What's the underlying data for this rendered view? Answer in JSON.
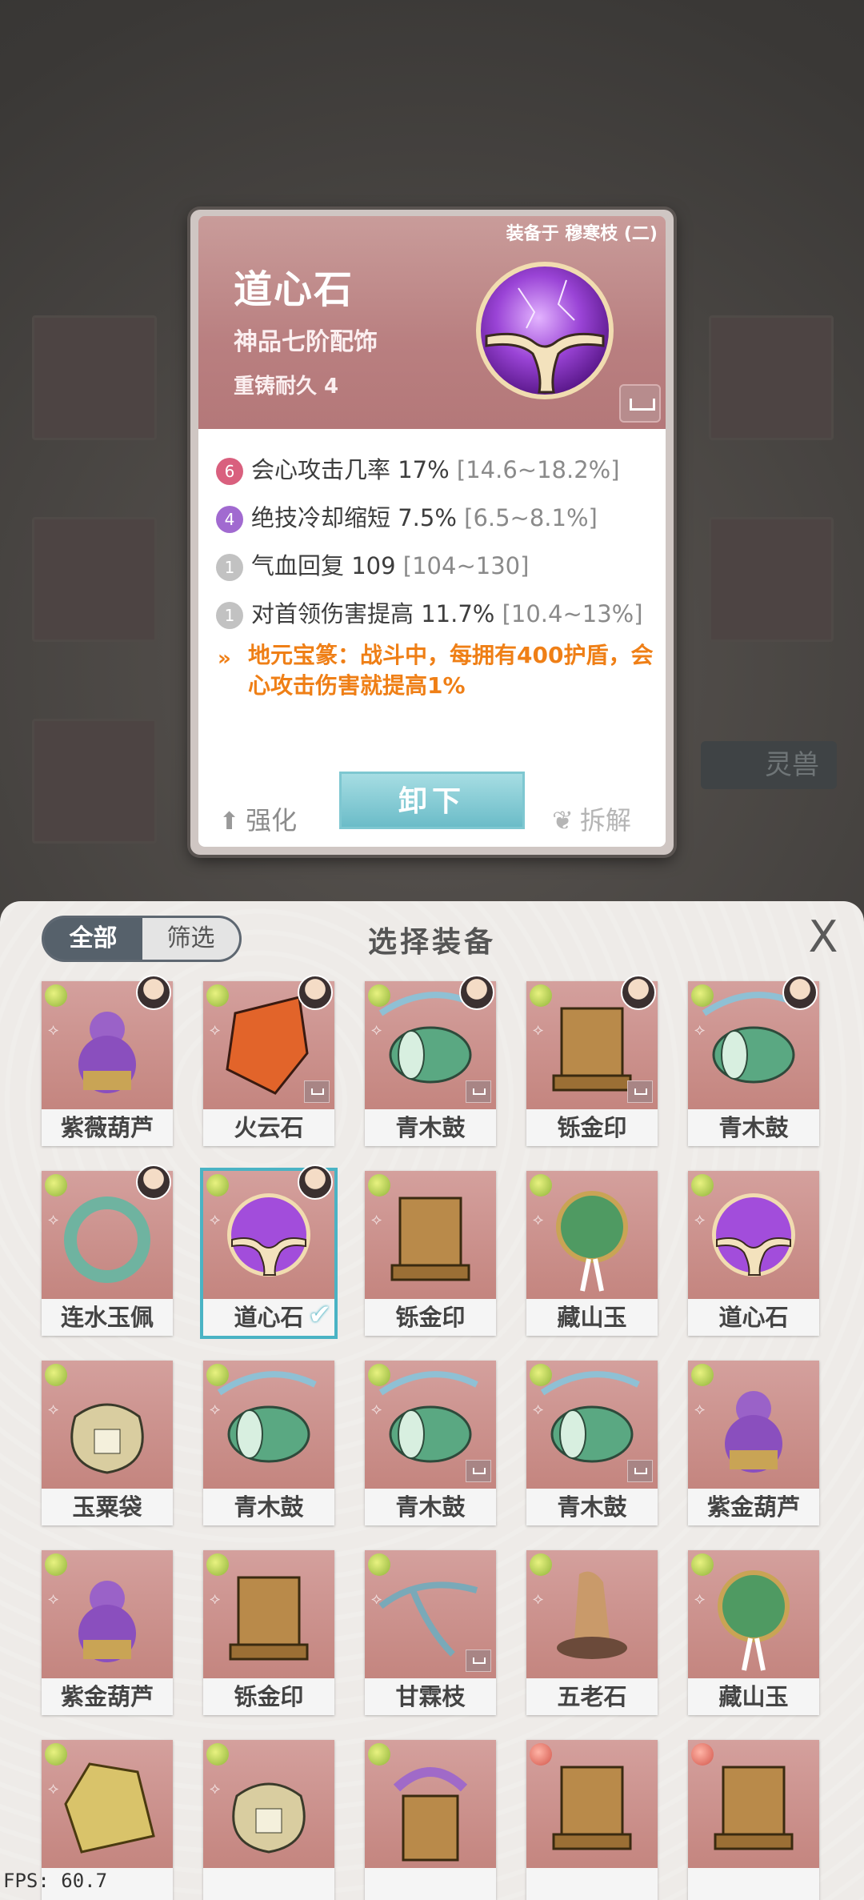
{
  "detail": {
    "equipped_text": "装备于 穆寒枝 (二)",
    "name": "道心石",
    "grade": "神品七阶配饰",
    "durability": "重铸耐久 4",
    "stats": [
      {
        "badge": "6",
        "badge_color": "#d9607e",
        "label": "会心攻击几率 17%",
        "range": "[14.6~18.2%]"
      },
      {
        "badge": "4",
        "badge_color": "#a16ad0",
        "label": "绝技冷却缩短 7.5%",
        "range": "[6.5~8.1%]"
      },
      {
        "badge": "1",
        "badge_color": "#c2c2c2",
        "label": "气血回复 109",
        "range": "[104~130]"
      },
      {
        "badge": "1",
        "badge_color": "#c2c2c2",
        "label": "对首领伤害提高 11.7%",
        "range": "[10.4~13%]"
      }
    ],
    "skill_icon": "»",
    "skill_text": "地元宝篆：战斗中，每拥有400护盾，会心攻击伤害就提高1%",
    "enhance_label": "强化",
    "unequip_label": "卸下",
    "disassemble_label": "拆解"
  },
  "panel": {
    "title": "选择装备",
    "tab_all": "全部",
    "tab_filter": "筛选",
    "close_glyph": "X"
  },
  "items": [
    {
      "name": "紫薇葫芦",
      "grade": "green",
      "avatar": true,
      "lock": false,
      "selected": false,
      "icon": "gourd-icon"
    },
    {
      "name": "火云石",
      "grade": "green",
      "avatar": true,
      "lock": true,
      "selected": false,
      "icon": "fire-stone-icon"
    },
    {
      "name": "青木鼓",
      "grade": "green",
      "avatar": true,
      "lock": true,
      "selected": false,
      "icon": "drum-icon"
    },
    {
      "name": "铄金印",
      "grade": "green",
      "avatar": true,
      "lock": true,
      "selected": false,
      "icon": "seal-icon"
    },
    {
      "name": "青木鼓",
      "grade": "green",
      "avatar": true,
      "lock": false,
      "selected": false,
      "icon": "drum-icon"
    },
    {
      "name": "连水玉佩",
      "grade": "green",
      "avatar": true,
      "lock": false,
      "selected": false,
      "icon": "jade-ring-icon"
    },
    {
      "name": "道心石",
      "grade": "green",
      "avatar": true,
      "lock": false,
      "selected": true,
      "icon": "orb-icon"
    },
    {
      "name": "铄金印",
      "grade": "green",
      "avatar": false,
      "lock": false,
      "selected": false,
      "icon": "seal-icon"
    },
    {
      "name": "藏山玉",
      "grade": "green",
      "avatar": false,
      "lock": false,
      "selected": false,
      "icon": "jade-pendant-icon"
    },
    {
      "name": "道心石",
      "grade": "green",
      "avatar": false,
      "lock": false,
      "selected": false,
      "icon": "orb-icon"
    },
    {
      "name": "玉粟袋",
      "grade": "green",
      "avatar": false,
      "lock": false,
      "selected": false,
      "icon": "pouch-icon"
    },
    {
      "name": "青木鼓",
      "grade": "green",
      "avatar": false,
      "lock": false,
      "selected": false,
      "icon": "drum-icon"
    },
    {
      "name": "青木鼓",
      "grade": "green",
      "avatar": false,
      "lock": true,
      "selected": false,
      "icon": "drum-icon"
    },
    {
      "name": "青木鼓",
      "grade": "green",
      "avatar": false,
      "lock": true,
      "selected": false,
      "icon": "drum-icon"
    },
    {
      "name": "紫金葫芦",
      "grade": "green",
      "avatar": false,
      "lock": false,
      "selected": false,
      "icon": "gourd-icon"
    },
    {
      "name": "紫金葫芦",
      "grade": "green",
      "avatar": false,
      "lock": false,
      "selected": false,
      "icon": "gourd-icon"
    },
    {
      "name": "铄金印",
      "grade": "green",
      "avatar": false,
      "lock": false,
      "selected": false,
      "icon": "seal-icon"
    },
    {
      "name": "甘霖枝",
      "grade": "green",
      "avatar": false,
      "lock": true,
      "selected": false,
      "icon": "branch-icon"
    },
    {
      "name": "五老石",
      "grade": "green",
      "avatar": false,
      "lock": false,
      "selected": false,
      "icon": "stone-icon"
    },
    {
      "name": "藏山玉",
      "grade": "green",
      "avatar": false,
      "lock": false,
      "selected": false,
      "icon": "jade-pendant-icon"
    },
    {
      "name": "",
      "grade": "green",
      "avatar": false,
      "lock": false,
      "selected": false,
      "icon": "rock-icon"
    },
    {
      "name": "",
      "grade": "green",
      "avatar": false,
      "lock": false,
      "selected": false,
      "icon": "pouch-icon"
    },
    {
      "name": "",
      "grade": "green",
      "avatar": false,
      "lock": false,
      "selected": false,
      "icon": "vase-icon"
    },
    {
      "name": "",
      "grade": "red",
      "avatar": false,
      "lock": false,
      "selected": false,
      "icon": "seal-icon"
    },
    {
      "name": "",
      "grade": "red",
      "avatar": false,
      "lock": false,
      "selected": false,
      "icon": "seal-icon"
    }
  ],
  "background": {
    "side_label": "灵兽"
  },
  "fps": "FPS: 60.7",
  "colors": {
    "skill_orange": "#ef7f16",
    "selected_border": "#4ab3c4",
    "card_top": "#b97f80"
  }
}
